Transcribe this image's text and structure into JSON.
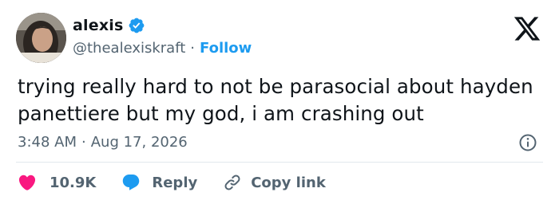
{
  "author": {
    "display_name": "alexis",
    "handle": "@thealexiskraft",
    "separator": "·",
    "follow_label": "Follow",
    "verified_color": "#1d9bf0"
  },
  "tweet": {
    "text": "trying really hard to not be parasocial about hayden panettiere but my god, i am crashing out",
    "time": "3:48 AM",
    "separator": "·",
    "date": "Aug 17, 2026"
  },
  "actions": {
    "likes": "10.9K",
    "reply_label": "Reply",
    "copy_label": "Copy link"
  },
  "colors": {
    "text": "#0f1419",
    "muted": "#536471",
    "accent": "#1d9bf0",
    "like": "#f91880",
    "divider": "#e1e8ed"
  },
  "icons": [
    "avatar",
    "verified-badge-icon",
    "x-logo-icon",
    "info-icon",
    "heart-icon",
    "reply-bubble-icon",
    "link-icon"
  ]
}
